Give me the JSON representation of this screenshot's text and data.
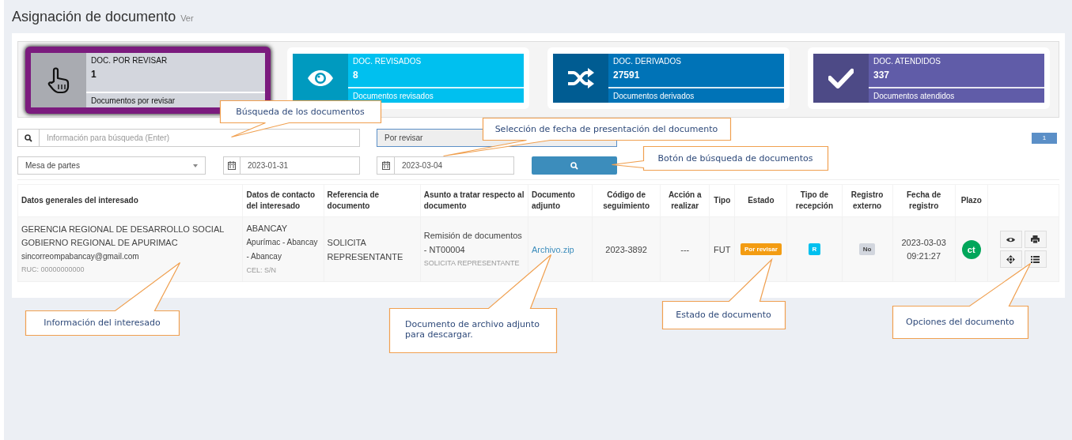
{
  "header": {
    "title": "Asignación de documento",
    "subtitle": "Ver"
  },
  "stats": [
    {
      "kind": "hand",
      "label": "DOC. POR REVISAR",
      "count": "1",
      "caption": "Documentos por revisar",
      "color": "#d3d6dd",
      "selected": true
    },
    {
      "kind": "eye",
      "label": "DOC. REVISADOS",
      "count": "8",
      "caption": "Documentos revisados",
      "color": "#00c0ef",
      "selected": false
    },
    {
      "kind": "shuffle",
      "label": "DOC. DERIVADOS",
      "count": "27591",
      "caption": "Documentos derivados",
      "color": "#0073b7",
      "selected": false
    },
    {
      "kind": "check",
      "label": "DOC. ATENDIDOS",
      "count": "337",
      "caption": "Documentos atendidos",
      "color": "#605ca8",
      "selected": false
    }
  ],
  "filters": {
    "search": {
      "placeholder": "Información para búsqueda (Enter)"
    },
    "status_select": "Por revisar",
    "area_select": "Mesa de partes",
    "date_from": "2023-01-31",
    "date_to": "2023-03-04"
  },
  "pagination": [
    {
      "label": "1",
      "selected": true
    }
  ],
  "table": {
    "columns": [
      "Datos generales del interesado",
      "Datos de contacto del interesado",
      "Referencia de documento",
      "Asunto a tratar respecto al documento",
      "Documento adjunto",
      "Código de seguimiento",
      "Acción a realizar",
      "Tipo",
      "Estado",
      "Tipo de recepción",
      "Registro externo",
      "Fecha de registro",
      "Plazo"
    ],
    "rows": [
      {
        "entity": "GERENCIA REGIONAL DE DESARROLLO SOCIAL",
        "parent_entity": "GOBIERNO REGIONAL DE APURIMAC",
        "email": "sincorreompabancay@gmail.com",
        "ruc": "RUC: 00000000000",
        "city": "ABANCAY",
        "location": "Apurímac - Abancay - Abancay",
        "phone": "CEL: S/N",
        "reference": "SOLICITA REPRESENTANTE",
        "subject": "Remisión de documentos - NT00004",
        "subject_note": "SOLICITA REPRESENTANTE",
        "attachment": "Archivo.zip",
        "tracking_code": "2023-3892",
        "action": "---",
        "type": "FUT",
        "status": {
          "label": "Por revisar",
          "color": "#f39c12"
        },
        "reception": {
          "label": "R",
          "color": "#00c0ef"
        },
        "external": {
          "label": "No",
          "color": "#d2d6de"
        },
        "registered": "2023-03-03 09:21:27",
        "deadline": {
          "label": "ct",
          "color": "#00a65a"
        }
      }
    ]
  },
  "callouts": [
    "Búsqueda de los documentos",
    "Selección de fecha de presentación del documento",
    "Botón de búsqueda de documentos",
    "Información del interesado",
    "Documento de archivo adjunto para descargar.",
    "Estado de documento",
    "Opciones del documento"
  ]
}
